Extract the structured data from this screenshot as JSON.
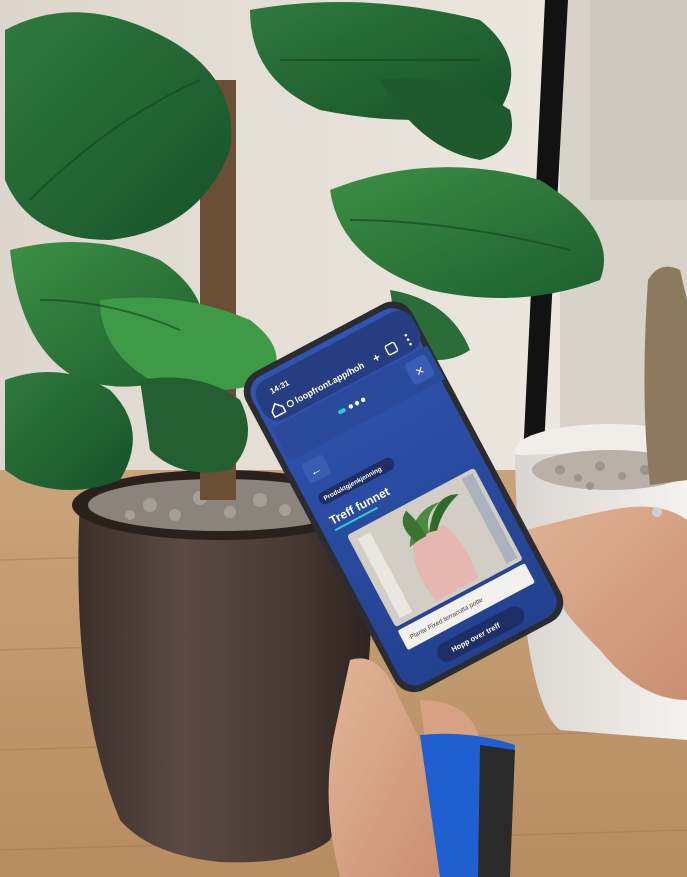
{
  "phone": {
    "status_time": "14:31",
    "url": "loopfront.app/hoh",
    "add_tab": "+",
    "close_label": "✕",
    "back_label": "←",
    "badge": "Produktgjenkjenning",
    "heading": "Treff funnet",
    "caption": "Plante Fixed terracotta potte",
    "primary_button": "Hopp over treff"
  },
  "colors": {
    "screen_blue": "#2c4fa6",
    "header_blue": "#2b4a9c",
    "accent_cyan": "#36c9d8",
    "button_dark": "#1d2f66",
    "phone_body": "#2a2c31",
    "scanner_blue": "#1f5fd0"
  },
  "icons": [
    "home-icon",
    "tune-icon",
    "tab-switcher-icon",
    "more-vert-icon",
    "close-icon",
    "back-arrow-icon"
  ]
}
